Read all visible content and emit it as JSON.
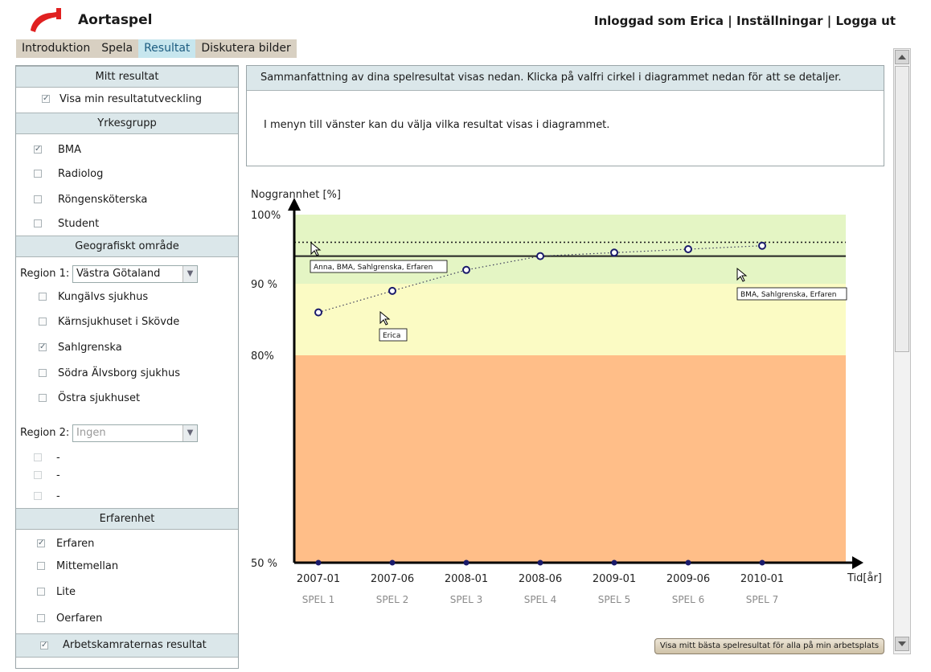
{
  "app": {
    "title": "Aortaspel",
    "user_logged_in": "Inloggad som Erica",
    "separator": "|",
    "settings": "Inställningar",
    "logout": "Logga ut"
  },
  "tabs": [
    {
      "label": "Introduktion",
      "active": false
    },
    {
      "label": "Spela",
      "active": false
    },
    {
      "label": "Resultat",
      "active": true
    },
    {
      "label": "Diskutera bilder",
      "active": false
    }
  ],
  "sidebar": {
    "my_result": {
      "header": "Mitt resultat",
      "items": [
        {
          "label": "Visa min resultatutveckling",
          "checked": true
        }
      ]
    },
    "occupation": {
      "header": "Yrkesgrupp",
      "items": [
        {
          "label": "BMA",
          "checked": true
        },
        {
          "label": "Radiolog",
          "checked": false
        },
        {
          "label": "Röngensköterska",
          "checked": false
        },
        {
          "label": "Student",
          "checked": false
        }
      ]
    },
    "geo": {
      "header": "Geografiskt område",
      "region1_label": "Region 1:",
      "region1_value": "Västra Götaland",
      "hospitals": [
        {
          "label": "Kungälvs sjukhus",
          "checked": false
        },
        {
          "label": "Kärnsjukhuset i Skövde",
          "checked": false
        },
        {
          "label": "Sahlgrenska",
          "checked": true
        },
        {
          "label": "Södra Älvsborg sjukhus",
          "checked": false
        },
        {
          "label": "Östra sjukhuset",
          "checked": false
        }
      ],
      "region2_label": "Region 2:",
      "region2_value": "Ingen",
      "region2_items": [
        {
          "label": "-",
          "checked": false
        },
        {
          "label": "-",
          "checked": false
        },
        {
          "label": "-",
          "checked": false
        }
      ]
    },
    "experience": {
      "header": "Erfarenhet",
      "items": [
        {
          "label": "Erfaren",
          "checked": true
        },
        {
          "label": "Mittemellan",
          "checked": false
        },
        {
          "label": "Lite",
          "checked": false
        },
        {
          "label": "Oerfaren",
          "checked": false
        }
      ]
    },
    "colleagues": {
      "label": "Arbetskamraternas resultat",
      "checked": true
    }
  },
  "main": {
    "summary": "Sammanfattning av dina spelresultat visas nedan. Klicka på valfri cirkel i diagrammet nedan för att se detaljer.",
    "info": "I menyn till vänster kan du välja vilka resultat visas i diagrammet.",
    "best_button": "Visa mitt bästa spelresultat för alla på min arbetsplats"
  },
  "colors": {
    "band_green": "#e4f5c4",
    "band_yellow": "#fbfbc4",
    "band_orange": "#ffbe88",
    "point": "#1a1a6b",
    "line": "#000000"
  },
  "chart_data": {
    "type": "line",
    "ylabel": "Noggrannhet [%]",
    "xlabel": "Tid[år]",
    "ytick_labels": [
      "100%",
      "90 %",
      "80%",
      "50 %"
    ],
    "categories": [
      "2007-01",
      "2007-06",
      "2008-01",
      "2008-06",
      "2009-01",
      "2009-06",
      "2010-01"
    ],
    "sublabels": [
      "SPEL 1",
      "SPEL 2",
      "SPEL 3",
      "SPEL 4",
      "SPEL 5",
      "SPEL 6",
      "SPEL 7"
    ],
    "bands": [
      {
        "from": 90,
        "to": 100,
        "color": "#e4f5c4"
      },
      {
        "from": 80,
        "to": 90,
        "color": "#fbfbc4"
      },
      {
        "from": 50,
        "to": 80,
        "color": "#ffbe88"
      }
    ],
    "series": [
      {
        "name": "Erica",
        "values": [
          86,
          89,
          92,
          94,
          94.5,
          95,
          95.5
        ]
      }
    ],
    "reference_lines": [
      {
        "name": "Anna, BMA, Sahlgrenska, Erfaren",
        "value": 96,
        "style": "dotted"
      },
      {
        "name": "BMA, Sahlgrenska, Erfaren",
        "value": 94,
        "style": "solid"
      }
    ]
  }
}
